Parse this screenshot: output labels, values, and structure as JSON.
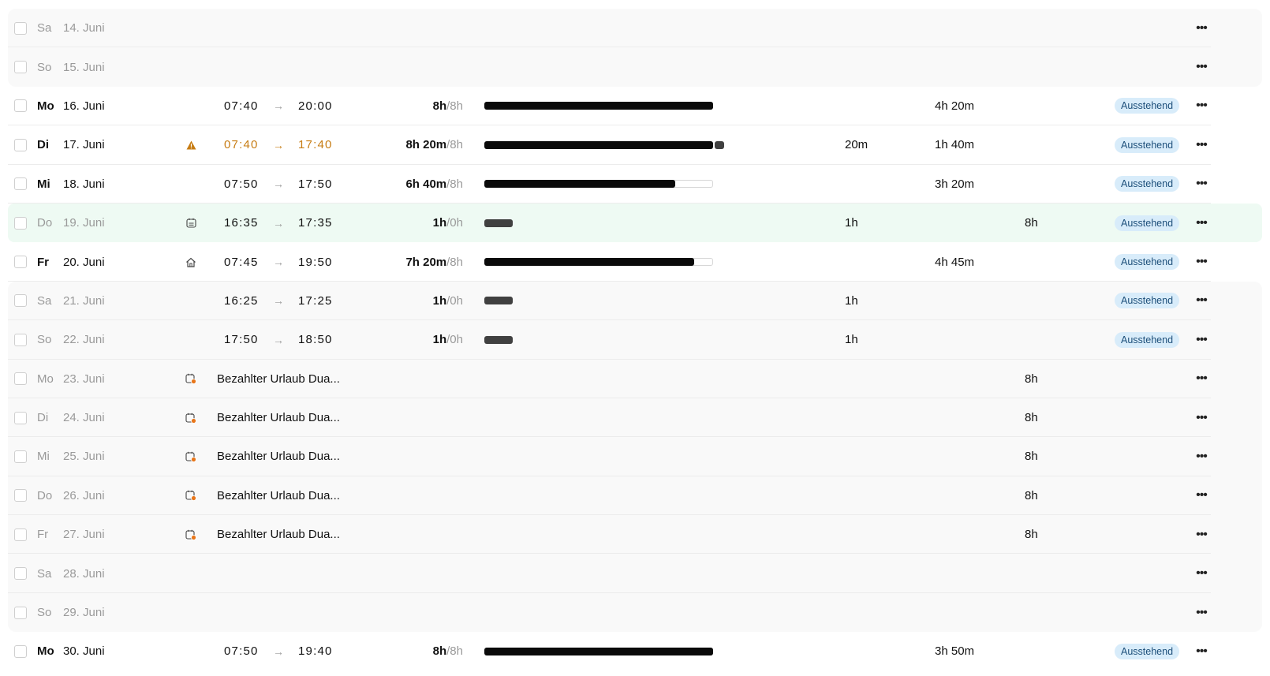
{
  "colors": {
    "warning": "#c77c13",
    "status_bg": "#d8ecfa",
    "status_text": "#1d4f7a",
    "vacation_dot": "#e8761a",
    "today_bg": "#eefaf3"
  },
  "rows": [
    {
      "day": "Sa",
      "date": "14. Juni",
      "muted": true,
      "shade": true
    },
    {
      "day": "So",
      "date": "15. Juni",
      "muted": true,
      "shade": true
    },
    {
      "day": "Mo",
      "date": "16. Juni",
      "start": "07:40",
      "arrow": "→",
      "end": "20:00",
      "worked": "8h",
      "target": "/8h",
      "progress": 1.0,
      "balance": "4h 20m",
      "status": "Ausstehend"
    },
    {
      "day": "Di",
      "date": "17. Juni",
      "icon": "warning-icon",
      "warn": true,
      "start": "07:40",
      "arrow": "→",
      "end": "17:40",
      "worked": "8h 20m",
      "target": "/8h",
      "progress": 1.0,
      "over_progress": 0.042,
      "overtime": "20m",
      "balance": "1h 40m",
      "status": "Ausstehend"
    },
    {
      "day": "Mi",
      "date": "18. Juni",
      "start": "07:50",
      "arrow": "→",
      "end": "17:50",
      "worked": "6h 40m",
      "target": "/8h",
      "progress": 0.8333,
      "balance": "3h 20m",
      "status": "Ausstehend"
    },
    {
      "day": "Do",
      "date": "19. Juni",
      "muted": true,
      "green": true,
      "icon": "calendar-icon",
      "start": "16:35",
      "arrow": "→",
      "end": "17:35",
      "worked": "1h",
      "target": "/0h",
      "progress": 0.125,
      "no_target": true,
      "overtime": "1h",
      "vacation": "8h",
      "status": "Ausstehend"
    },
    {
      "day": "Fr",
      "date": "20. Juni",
      "icon": "home-icon",
      "start": "07:45",
      "arrow": "→",
      "end": "19:50",
      "worked": "7h 20m",
      "target": "/8h",
      "progress": 0.9167,
      "balance": "4h 45m",
      "status": "Ausstehend"
    },
    {
      "day": "Sa",
      "date": "21. Juni",
      "muted": true,
      "shade": true,
      "start": "16:25",
      "arrow": "→",
      "end": "17:25",
      "worked": "1h",
      "target": "/0h",
      "progress": 0.125,
      "no_target": true,
      "overtime": "1h",
      "status": "Ausstehend"
    },
    {
      "day": "So",
      "date": "22. Juni",
      "muted": true,
      "shade": true,
      "start": "17:50",
      "arrow": "→",
      "end": "18:50",
      "worked": "1h",
      "target": "/0h",
      "progress": 0.125,
      "no_target": true,
      "overtime": "1h",
      "status": "Ausstehend"
    },
    {
      "day": "Mo",
      "date": "23. Juni",
      "muted": true,
      "shade": true,
      "icon": "vacation-calendar-icon",
      "absence": "Bezahlter Urlaub Dua...",
      "vacation": "8h"
    },
    {
      "day": "Di",
      "date": "24. Juni",
      "muted": true,
      "shade": true,
      "icon": "vacation-calendar-icon",
      "absence": "Bezahlter Urlaub Dua...",
      "vacation": "8h"
    },
    {
      "day": "Mi",
      "date": "25. Juni",
      "muted": true,
      "shade": true,
      "icon": "vacation-calendar-icon",
      "absence": "Bezahlter Urlaub Dua...",
      "vacation": "8h"
    },
    {
      "day": "Do",
      "date": "26. Juni",
      "muted": true,
      "shade": true,
      "icon": "vacation-calendar-icon",
      "absence": "Bezahlter Urlaub Dua...",
      "vacation": "8h"
    },
    {
      "day": "Fr",
      "date": "27. Juni",
      "muted": true,
      "shade": true,
      "icon": "vacation-calendar-icon",
      "absence": "Bezahlter Urlaub Dua...",
      "vacation": "8h"
    },
    {
      "day": "Sa",
      "date": "28. Juni",
      "muted": true,
      "shade": true
    },
    {
      "day": "So",
      "date": "29. Juni",
      "muted": true,
      "shade": true
    },
    {
      "day": "Mo",
      "date": "30. Juni",
      "start": "07:50",
      "arrow": "→",
      "end": "19:40",
      "worked": "8h",
      "target": "/8h",
      "progress": 1.0,
      "balance": "3h 50m",
      "status": "Ausstehend"
    }
  ]
}
